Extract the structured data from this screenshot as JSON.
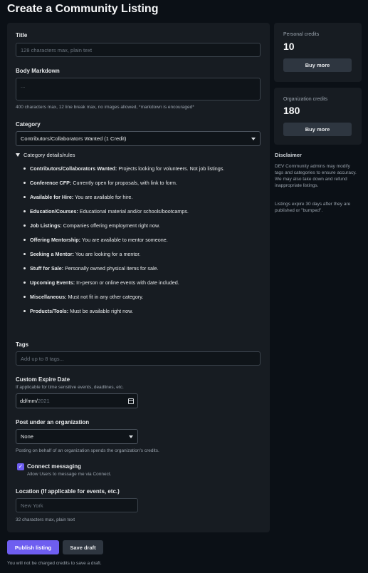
{
  "page_title": "Create a Community Listing",
  "form": {
    "title": {
      "label": "Title",
      "placeholder": "128 characters max, plain text"
    },
    "body": {
      "label": "Body Markdown",
      "placeholder": "...",
      "hint": "400 characters max, 12 line break max, no images allowed, *markdown is encouraged*"
    },
    "category": {
      "label": "Category",
      "selected": "Contributors/Collaborators Wanted (1 Credit)"
    },
    "details": {
      "summary": "Category details/rules",
      "rules": [
        {
          "name": "Contributors/Collaborators Wanted:",
          "desc": "Projects looking for volunteers. Not job listings."
        },
        {
          "name": "Conference CFP:",
          "desc": "Currently open for proposals, with link to form."
        },
        {
          "name": "Available for Hire:",
          "desc": "You are available for hire."
        },
        {
          "name": "Education/Courses:",
          "desc": "Educational material and/or schools/bootcamps."
        },
        {
          "name": "Job Listings:",
          "desc": "Companies offering employment right now."
        },
        {
          "name": "Offering Mentorship:",
          "desc": "You are available to mentor someone."
        },
        {
          "name": "Seeking a Mentor:",
          "desc": "You are looking for a mentor."
        },
        {
          "name": "Stuff for Sale:",
          "desc": "Personally owned physical items for sale."
        },
        {
          "name": "Upcoming Events:",
          "desc": "In-person or online events with date included."
        },
        {
          "name": "Miscellaneous:",
          "desc": "Must not fit in any other category."
        },
        {
          "name": "Products/Tools:",
          "desc": "Must be available right now."
        }
      ]
    },
    "tags": {
      "label": "Tags",
      "placeholder": "Add up to 8 tags..."
    },
    "expire": {
      "label": "Custom Expire Date",
      "hint": "If applicable for time sensitive events, deadlines, etc.",
      "value_prefix": "dd/mm/",
      "value_year": "2021"
    },
    "organization": {
      "label": "Post under an organization",
      "selected": "None",
      "hint": "Posting on behalf of an organization spends the organization's credits."
    },
    "connect": {
      "label": "Connect messaging",
      "hint": "Allow Users to message me via Connect.",
      "checked": true,
      "check_glyph": "✓"
    },
    "location": {
      "label": "Location (If applicable for events, etc.)",
      "placeholder": "New York",
      "hint": "32 characters max, plain text"
    }
  },
  "sidebar": {
    "personal": {
      "label": "Personal credits",
      "value": "10",
      "button": "Buy more"
    },
    "organization": {
      "label": "Organization credits",
      "value": "180",
      "button": "Buy more"
    },
    "disclaimer": {
      "heading": "Disclaimer",
      "p1": "DEV Community admins may modify tags and categories to ensure accuracy. We may also take down and refund inappropriate listings.",
      "p2": "Listings expire 30 days after they are published or \"bumped\"."
    }
  },
  "actions": {
    "publish": "Publish listing",
    "save_draft": "Save draft",
    "note": "You will not be charged credits to save a draft."
  },
  "colors": {
    "accent": "#6e5ef0",
    "background": "#0b1016",
    "card": "#171c22"
  }
}
